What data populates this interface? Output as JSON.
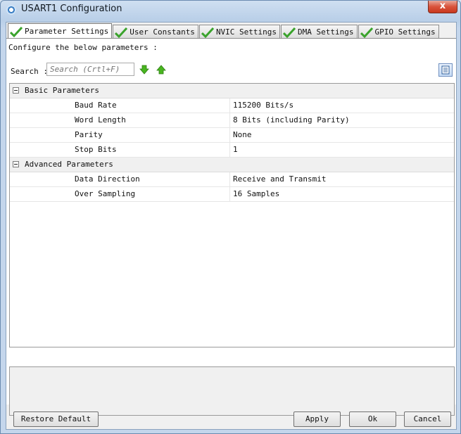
{
  "window": {
    "title": "USART1 Configuration",
    "close_glyph": "x"
  },
  "tabs": [
    {
      "label": "Parameter Settings",
      "active": true,
      "icon": "check-icon"
    },
    {
      "label": "User Constants",
      "active": false,
      "icon": "check-icon"
    },
    {
      "label": "NVIC Settings",
      "active": false,
      "icon": "check-icon"
    },
    {
      "label": "DMA Settings",
      "active": false,
      "icon": "check-icon"
    },
    {
      "label": "GPIO Settings",
      "active": false,
      "icon": "check-icon"
    }
  ],
  "configure_label": "Configure the below parameters :",
  "search": {
    "label": "Search :",
    "placeholder": "Search (Crtl+F)"
  },
  "groups": [
    {
      "label": "Basic Parameters",
      "rows": [
        {
          "name": "Baud Rate",
          "value": "115200 Bits/s"
        },
        {
          "name": "Word Length",
          "value": "8 Bits (including Parity)"
        },
        {
          "name": "Parity",
          "value": "None"
        },
        {
          "name": "Stop Bits",
          "value": "1"
        }
      ]
    },
    {
      "label": "Advanced Parameters",
      "rows": [
        {
          "name": "Data Direction",
          "value": "Receive and Transmit"
        },
        {
          "name": "Over Sampling",
          "value": "16 Samples"
        }
      ]
    }
  ],
  "buttons": {
    "restore": "Restore Default",
    "apply": "Apply",
    "ok": "Ok",
    "cancel": "Cancel"
  },
  "colors": {
    "check": "#3aa32c",
    "arrow": "#49b520",
    "title_bar": "#b9cfe8",
    "close": "#d9533b"
  }
}
